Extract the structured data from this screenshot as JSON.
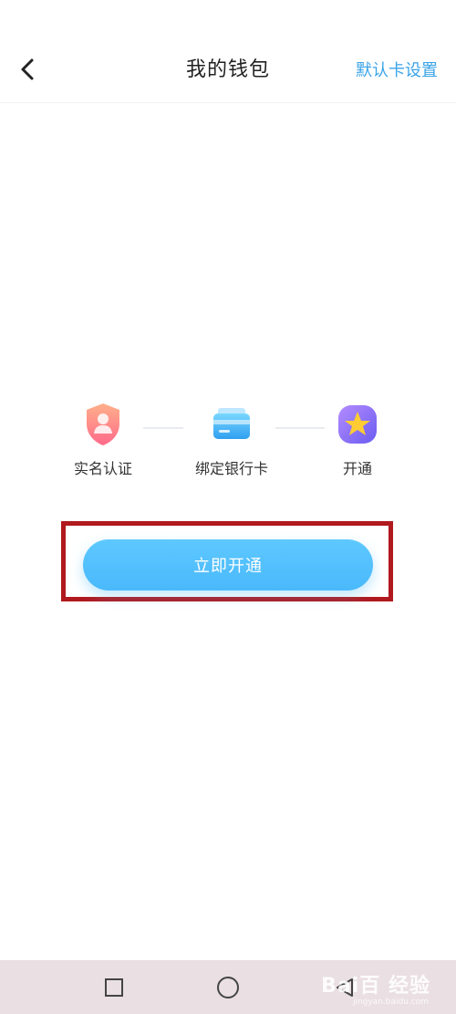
{
  "header": {
    "title": "我的钱包",
    "default_card_label": "默认卡设置"
  },
  "steps": [
    {
      "label": "实名认证",
      "icon": "identity-shield-icon"
    },
    {
      "label": "绑定银行卡",
      "icon": "bank-card-icon"
    },
    {
      "label": "开通",
      "icon": "star-badge-icon"
    }
  ],
  "action": {
    "open_label": "立即开通"
  },
  "watermark": {
    "text": "Bai百 经验",
    "sub": "jingyan.baidu.com"
  },
  "colors": {
    "accent": "#3aa3e8",
    "button": "#4ab9fb",
    "highlight": "#b0191e",
    "navbar": "#eadfe2"
  }
}
